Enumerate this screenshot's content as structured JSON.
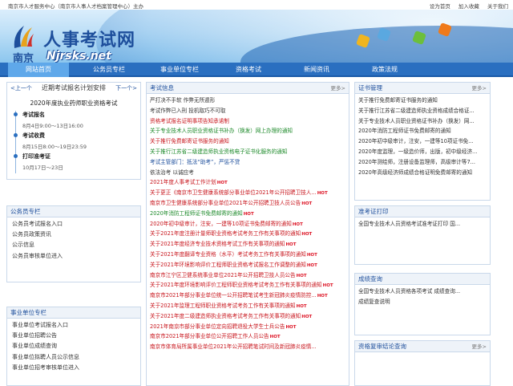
{
  "topbar": {
    "left": "南京市人才服务中心（南京市人事人才档案管理中心）主办",
    "links": [
      "设为首页",
      "加入收藏",
      "关于我们"
    ]
  },
  "brand": {
    "title": "人事考试网",
    "city": "南京",
    "url": "Njrsks.net"
  },
  "nav": {
    "items": [
      "网站首页",
      "公务员专栏",
      "事业单位专栏",
      "资格考试",
      "新闻资讯",
      "政策法规"
    ]
  },
  "schedule": {
    "prev": "<上一个",
    "next": "下一个>",
    "heading": "近期考试报名计划安排",
    "exam": "2020年度执业药师职业资格考试",
    "steps": [
      {
        "title": "考试报名",
        "date": "8月4日9:00～13日16:00"
      },
      {
        "title": "考试收费",
        "date": "8月15日8:00～19日23:59"
      },
      {
        "title": "打印准考证",
        "date": "10月17日～23日"
      }
    ]
  },
  "civil": {
    "title": "公务员专栏",
    "items": [
      "公务员考试报名入口",
      "公务员政策资讯",
      "公示信息",
      "公务员审核单位进入"
    ]
  },
  "inst": {
    "title": "事业单位专栏",
    "items": [
      "事业单位考试报名入口",
      "事业单位招聘公告",
      "事业单位成绩查询",
      "事业单位拟聘人员公示信息",
      "事业单位招考审核单位进入"
    ]
  },
  "exam_info": {
    "title": "考试信息",
    "more": "更多>",
    "items": [
      {
        "text": "严打决不手软 作弊无所遁形",
        "color": "dark",
        "hot": false
      },
      {
        "text": "考试作弊已入刑 投机取巧不可取",
        "color": "dark",
        "hot": false
      },
      {
        "text": "资格考试报名证明事项告知承诺制",
        "color": "red",
        "hot": false
      },
      {
        "text": "关于专业技术人员职业资格证书补办（换发）网上办理的通知",
        "color": "green",
        "hot": false
      },
      {
        "text": "关于推行免费邮寄证书服务的通知",
        "color": "red",
        "hot": false
      },
      {
        "text": "关于推行江苏省二级建造师执业资格电子证书化服务的通知",
        "color": "green",
        "hot": false
      },
      {
        "text": "考试主管部门：抵法“助考”，严惩不贷",
        "color": "blue",
        "hot": false
      },
      {
        "text": "依法治考 以诚应考",
        "color": "dark",
        "hot": false
      },
      {
        "text": "2021年度人事考试工作计划",
        "color": "red",
        "hot": true
      },
      {
        "text": "关于更正《南京市卫生健康系统部分事业单位2021年公开招聘卫技人...",
        "color": "red",
        "hot": true
      },
      {
        "text": "南京市卫生健康系统部分事业单位2021年公开招聘卫技人员公告",
        "color": "red",
        "hot": true
      },
      {
        "text": "2020年消防工程师证书免费邮寄的通知",
        "color": "green",
        "hot": true
      },
      {
        "text": "2020年初中级审计，注安，一建等10项证书免费邮寄的通知",
        "color": "red",
        "hot": true
      },
      {
        "text": "关于2021年度注册计量师职业资格考试考务工作有关事项的通知",
        "color": "red",
        "hot": true
      },
      {
        "text": "关于2021年度经济专业技术资格考试工作有关事项的通知",
        "color": "red",
        "hot": true
      },
      {
        "text": "关于2021年度翻译专业资格（水平）考试考务工作有关事项的通知",
        "color": "red",
        "hot": true
      },
      {
        "text": "关于2021年环境影响评价工程师职业资格考试报名工作调整的通知",
        "color": "red",
        "hot": true
      },
      {
        "text": "南京市江宁区卫健系统事业单位2021年公开招聘卫技人员公告",
        "color": "red",
        "hot": true
      },
      {
        "text": "关于2021年度环境影响评价工程师职业资格考试考务工作有关事项的通知",
        "color": "red",
        "hot": true
      },
      {
        "text": "南京市2021年部分事业单位统一公开招聘笔试考生新冠肺炎疫情防控...",
        "color": "red",
        "hot": true
      },
      {
        "text": "关于2021年监理工程师职业资格考试考务工作有关事项的通知",
        "color": "red",
        "hot": true
      },
      {
        "text": "关于2021年度二级建造师执业资格考试考务工作有关事项的通知",
        "color": "red",
        "hot": true
      },
      {
        "text": "2021年南京市部分事业单位定向招聘退役大学生士兵公告",
        "color": "red",
        "hot": true
      },
      {
        "text": "南京市2021年部分事业单位公开招聘工作人员公告",
        "color": "red",
        "hot": true
      },
      {
        "text": "南京市体育局所属事业单位2021年公开招聘笔试时间及新冠肺炎疫情...",
        "color": "red",
        "hot": false
      }
    ]
  },
  "cert": {
    "title": "证书管理",
    "more": "更多>",
    "items": [
      "关于推行免费邮寄证书服务的通知",
      "关于推行江苏省二级建造师执业资格成绩合格证...",
      "关于专业技术人员职业资格证书补办（换发）网...",
      "2020年消防工程师证书免费邮寄的通知",
      "2020年初中级审计，注安，一建等10项证书免...",
      "2020年度监理，一级造价师，出版，初中级经济...",
      "2020年测绘师，注册设备监理师，高级审计等7...",
      "2020年高级经济师成绩合格证明免费邮寄的通知"
    ]
  },
  "admit": {
    "title": "准考证打印",
    "items": [
      "全国专业技术人员资格考试准考证打印 国..."
    ]
  },
  "score": {
    "title": "成绩查询",
    "items": [
      "全国专业技术人员资格各项考试 成绩查询...",
      "成绩复查说明"
    ]
  },
  "review": {
    "title": "资格复审结论查询",
    "more": "更多>"
  },
  "colors": {
    "nav_bg": "#2a6fc0",
    "nav_active": "#5fa8ea",
    "panel_title": "#1e4f9c",
    "red": "#c8161d",
    "green": "#1d8a2a"
  }
}
